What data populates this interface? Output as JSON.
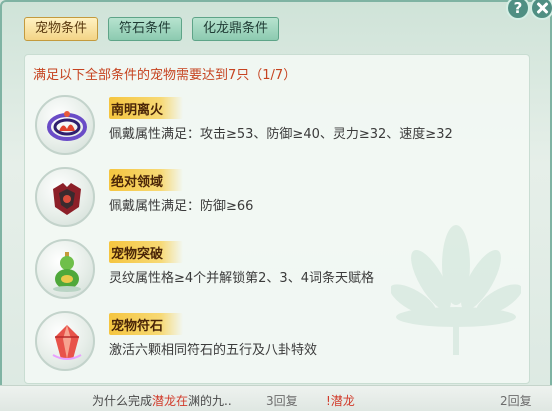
{
  "tabs": [
    {
      "label": "宠物条件",
      "active": true
    },
    {
      "label": "符石条件",
      "active": false
    },
    {
      "label": "化龙鼎条件",
      "active": false
    }
  ],
  "help_label": "?",
  "summary": "满足以下全部条件的宠物需要达到7只（1/7）",
  "requirements": [
    {
      "name": "南明离火",
      "desc": "佩戴属性满足：攻击≥53、防御≥40、灵力≥32、速度≥32",
      "icon": "fire-ring-icon"
    },
    {
      "name": "绝对领域",
      "desc": "佩戴属性满足：防御≥66",
      "icon": "armor-icon"
    },
    {
      "name": "宠物突破",
      "desc": "灵纹属性格≥4个并解锁第2、3、4词条天赋格",
      "icon": "gourd-icon"
    },
    {
      "name": "宠物符石",
      "desc": "激活六颗相同符石的五行及八卦特效",
      "icon": "crystal-icon"
    }
  ],
  "bottom_bar": {
    "text1_prefix": "为什么完成",
    "text1_highlight": "潜龙在",
    "text1_suffix": "渊的九..",
    "reply1": "3回复",
    "text2": "!潜龙",
    "reply2": "2回复"
  }
}
